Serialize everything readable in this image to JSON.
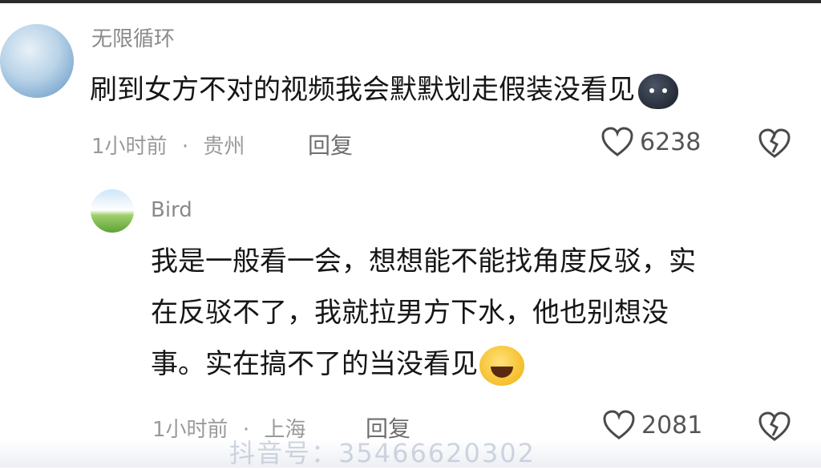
{
  "comments": [
    {
      "username": "无限循环",
      "text": "刷到女方不对的视频我会默默划走假装没看见",
      "emoji": "dark-blob-emoji",
      "time": "1小时前",
      "separator": "·",
      "location": "贵州",
      "reply_label": "回复",
      "likes": "6238"
    },
    {
      "username": "Bird",
      "lines": [
        "我是一般看一会，想想能不能找角度反驳，实",
        "在反驳不了，我就拉男方下水，他也别想没",
        "事。实在搞不了的当没看见"
      ],
      "emoji": "laughing-tears-emoji",
      "time": "1小时前",
      "separator": "·",
      "location": "上海",
      "reply_label": "回复",
      "likes": "2081"
    }
  ],
  "watermark": "抖音号：35466620302",
  "colors": {
    "text": "#161616",
    "meta": "#9a9a9a",
    "username": "#8a8a8a",
    "icon": "#4a4a4a"
  }
}
